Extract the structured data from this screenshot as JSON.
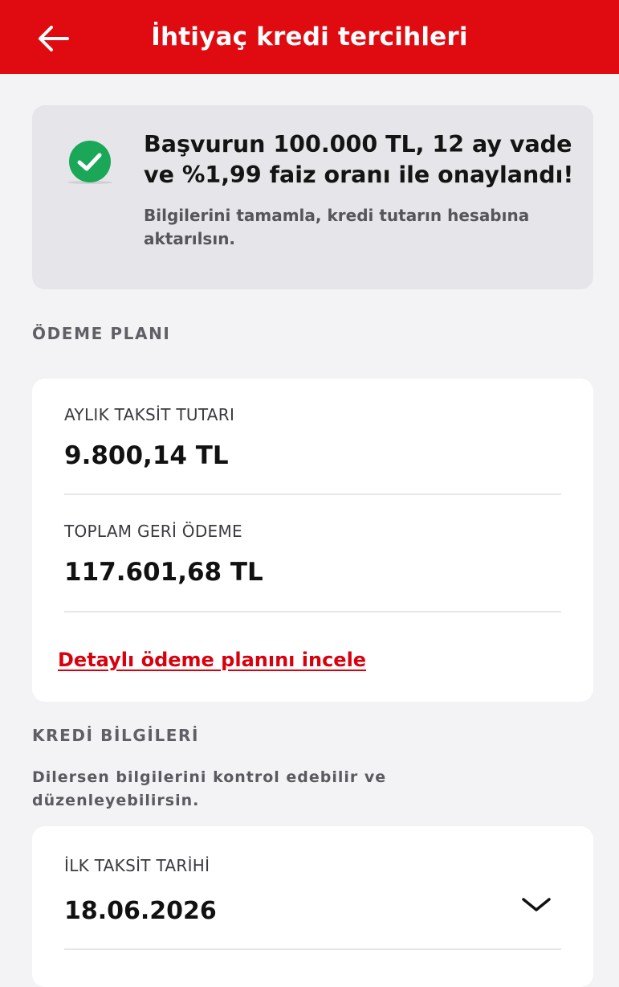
{
  "header": {
    "title": "İhtiyaç kredi tercihleri"
  },
  "approval": {
    "title": "Başvurun 100.000 TL, 12 ay vade ve %1,99 faiz oranı ile onaylandı!",
    "subtitle": "Bilgilerini tamamla, kredi tutarın hesabına aktarılsın."
  },
  "payment_plan": {
    "section_label": "ÖDEME PLANI",
    "monthly_label": "AYLIK TAKSİT TUTARI",
    "monthly_value": "9.800,14 TL",
    "total_label": "TOPLAM GERİ ÖDEME",
    "total_value": "117.601,68 TL",
    "detail_link": "Detaylı ödeme planını incele"
  },
  "credit_info": {
    "section_label": "KREDİ BİLGİLERİ",
    "description": "Dilersen bilgilerini kontrol edebilir ve düzenleyebilirsin.",
    "first_installment_label": "İLK TAKSİT TARİHİ",
    "first_installment_value": "18.06.2026"
  },
  "colors": {
    "brand_red": "#e00b11",
    "success_green": "#1aa757",
    "link_red": "#d9000d"
  },
  "icons": {
    "back": "arrow-left-icon",
    "success": "check-circle-icon",
    "dropdown": "chevron-down-icon"
  }
}
